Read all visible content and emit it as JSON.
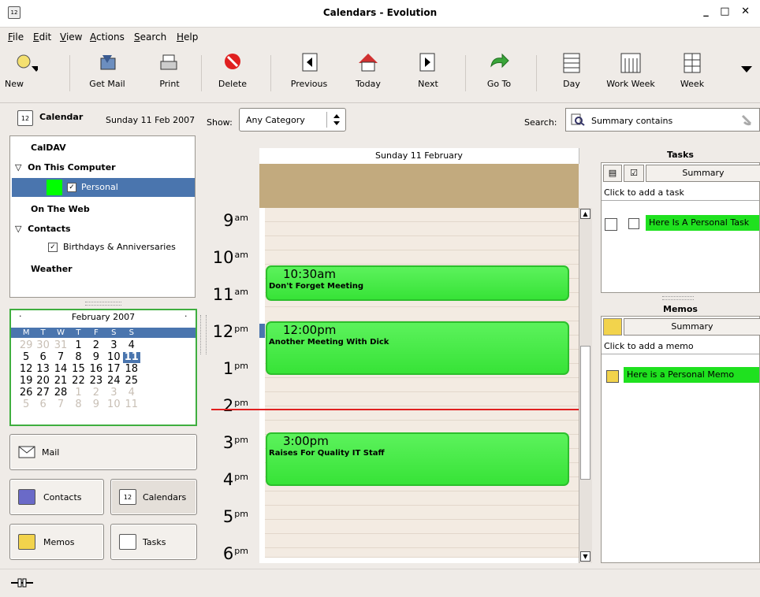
{
  "window": {
    "title": "Calendars - Evolution",
    "app_icon": "12",
    "controls": "_ □ ✕"
  },
  "menu": [
    "File",
    "Edit",
    "View",
    "Actions",
    "Search",
    "Help"
  ],
  "toolbar": {
    "new": "New",
    "get_mail": "Get Mail",
    "print": "Print",
    "delete": "Delete",
    "previous": "Previous",
    "today": "Today",
    "next": "Next",
    "goto": "Go To",
    "day": "Day",
    "work_week": "Work Week",
    "week": "Week"
  },
  "sidebar": {
    "title": "Calendar",
    "date": "Sunday 11 Feb 2007",
    "sources": {
      "caldav": "CalDAV",
      "on_this_computer": "On This Computer",
      "personal": "Personal",
      "on_the_web": "On The Web",
      "contacts": "Contacts",
      "birthdays": "Birthdays & Anniversaries",
      "weather": "Weather"
    },
    "personal_color": "#00ff00"
  },
  "filter": {
    "show_label": "Show:",
    "category": "Any Category",
    "search_label": "Search:",
    "search_text": "Summary contains"
  },
  "minical": {
    "month": "February 2007",
    "dow": [
      "M",
      "T",
      "W",
      "T",
      "F",
      "S",
      "S"
    ],
    "weeks": [
      [
        "29",
        "30",
        "31",
        "1",
        "2",
        "3",
        "4"
      ],
      [
        "5",
        "6",
        "7",
        "8",
        "9",
        "10",
        "11"
      ],
      [
        "12",
        "13",
        "14",
        "15",
        "16",
        "17",
        "18"
      ],
      [
        "19",
        "20",
        "21",
        "22",
        "23",
        "24",
        "25"
      ],
      [
        "26",
        "27",
        "28",
        "1",
        "2",
        "3",
        "4"
      ],
      [
        "5",
        "6",
        "7",
        "8",
        "9",
        "10",
        "11"
      ]
    ],
    "selected": "11"
  },
  "switcher": {
    "mail": "Mail",
    "contacts": "Contacts",
    "calendars": "Calendars",
    "memos": "Memos",
    "tasks": "Tasks"
  },
  "dayview": {
    "header": "Sunday 11 February",
    "hours": [
      {
        "h": "9",
        "ap": "am"
      },
      {
        "h": "10",
        "ap": "am"
      },
      {
        "h": "11",
        "ap": "am"
      },
      {
        "h": "12",
        "ap": "pm"
      },
      {
        "h": "1",
        "ap": "pm"
      },
      {
        "h": "2",
        "ap": "pm"
      },
      {
        "h": "3",
        "ap": "pm"
      },
      {
        "h": "4",
        "ap": "pm"
      },
      {
        "h": "5",
        "ap": "pm"
      },
      {
        "h": "6",
        "ap": "pm"
      }
    ],
    "events": [
      {
        "time": "10:30am",
        "summary": "Don't Forget Meeting"
      },
      {
        "time": "12:00pm",
        "summary": "Another Meeting With Dick"
      },
      {
        "time": "3:00pm",
        "summary": "Raises For Quality IT Staff"
      }
    ]
  },
  "tasks": {
    "title": "Tasks",
    "column": "Summary",
    "add": "Click to add a task",
    "items": [
      "Here Is A Personal Task"
    ]
  },
  "memos": {
    "title": "Memos",
    "column": "Summary",
    "add": "Click to add a memo",
    "items": [
      "Here is a Personal Memo"
    ]
  },
  "colors": {
    "event_fill": "#3ee83e",
    "event_border": "#2cbf2c",
    "selection": "#4a75ae",
    "allday": "#c2aa7e",
    "now_line": "#e02020"
  }
}
